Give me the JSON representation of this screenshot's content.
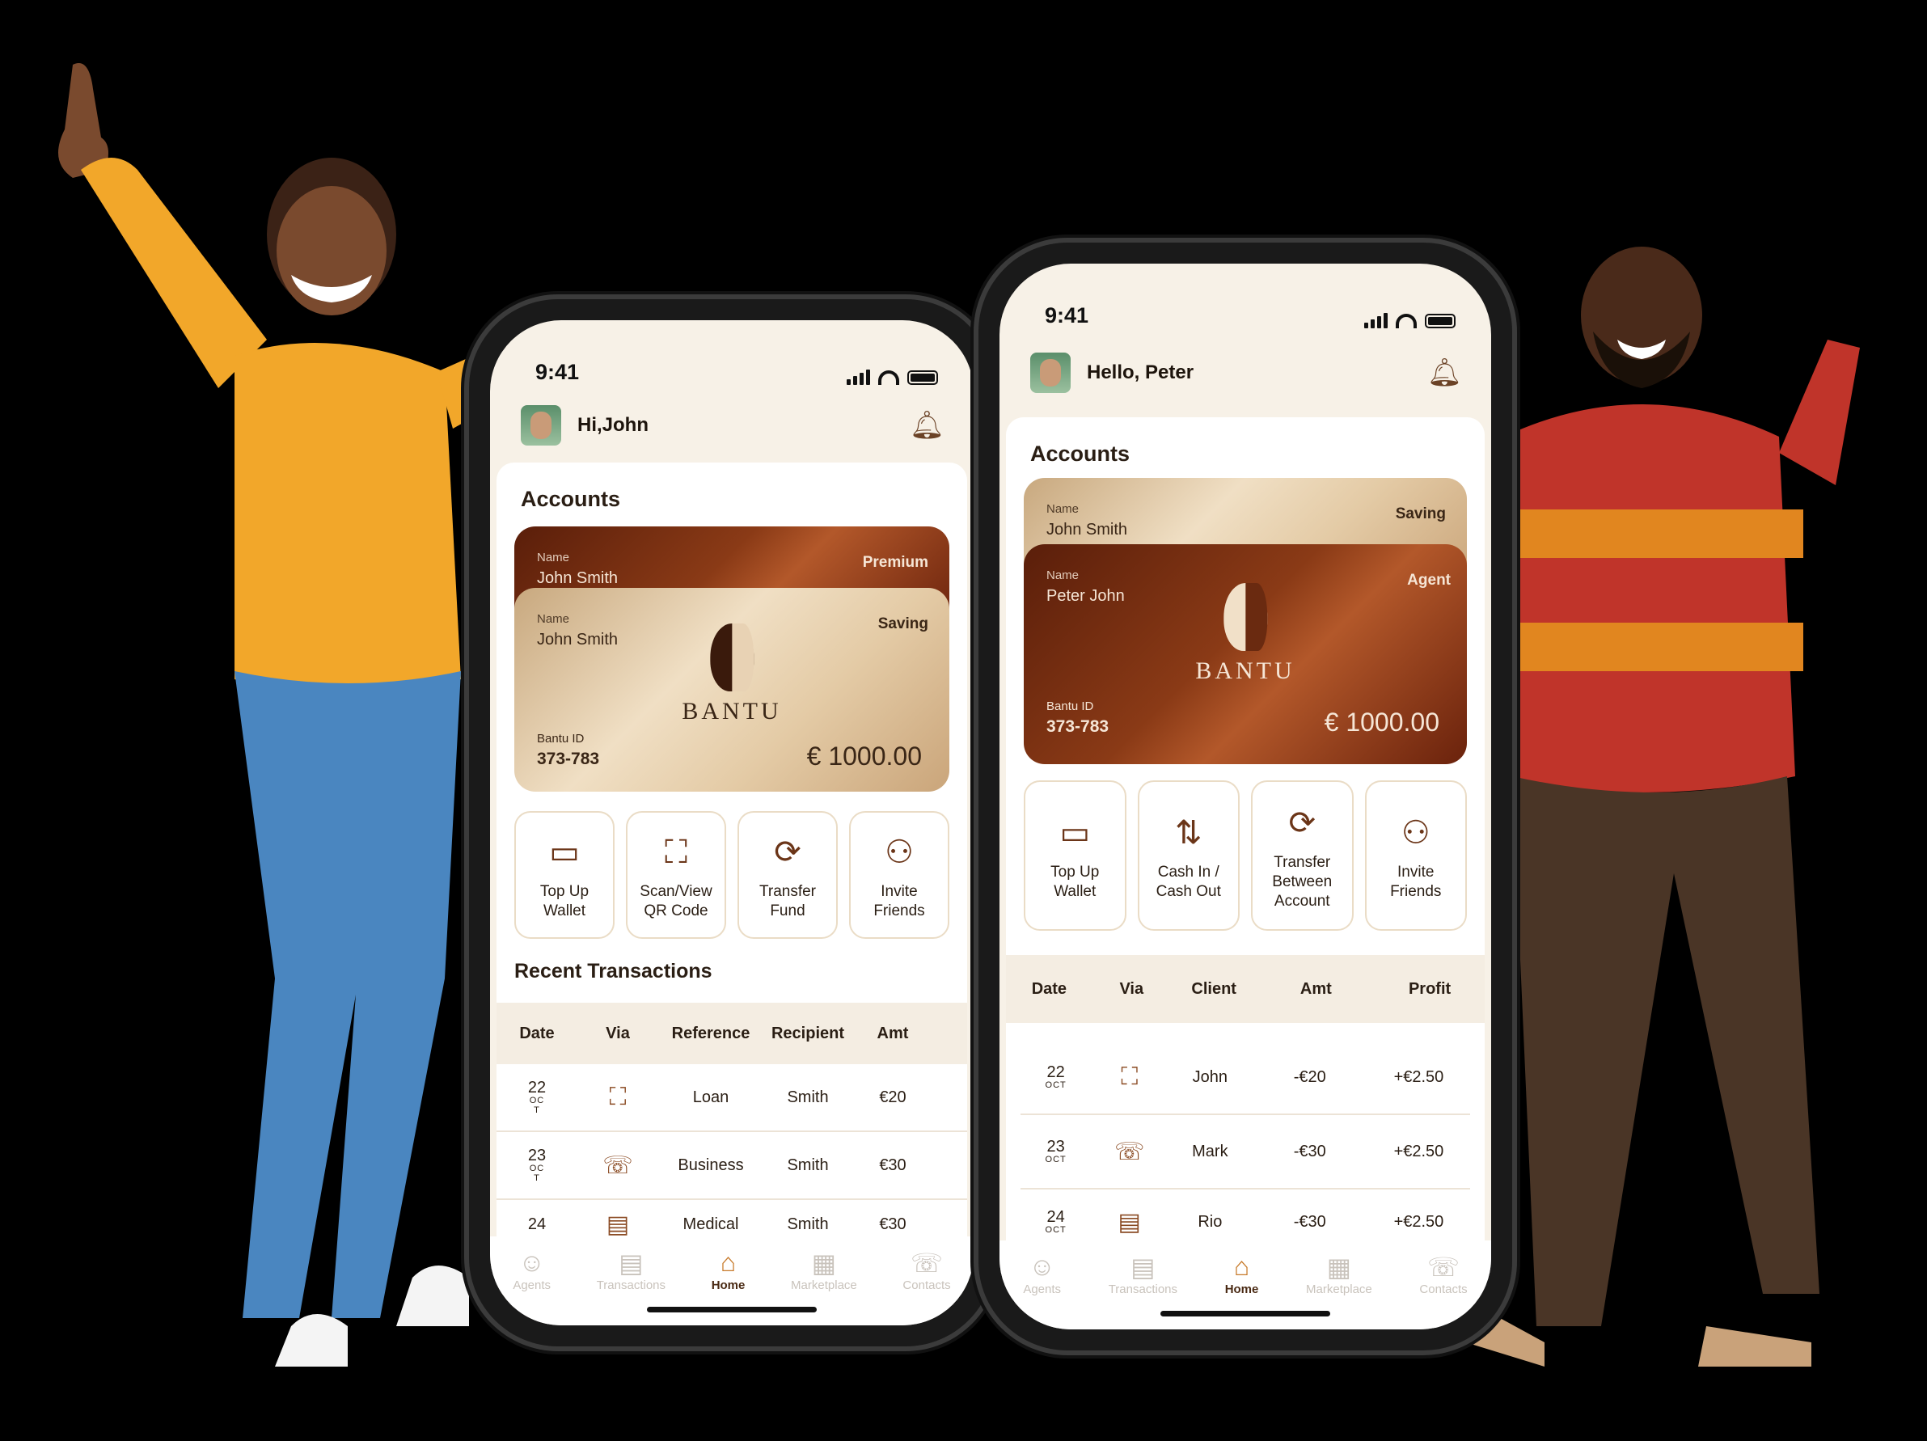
{
  "phone_left": {
    "time": "9:41",
    "greeting": "Hi,John",
    "accounts_title": "Accounts",
    "card_back": {
      "name_label": "Name",
      "name": "John Smith",
      "type": "Premium"
    },
    "card_front": {
      "name_label": "Name",
      "name": "John Smith",
      "type": "Saving",
      "id_label": "Bantu ID",
      "id": "373-783",
      "amount": "€ 1000.00",
      "brand": "BANTU"
    },
    "actions": [
      {
        "label": "Top Up\nWallet",
        "icon": "wallet-icon"
      },
      {
        "label": "Scan/View\nQR Code",
        "icon": "qr-icon"
      },
      {
        "label": "Transfer\nFund",
        "icon": "transfer-icon"
      },
      {
        "label": "Invite\nFriends",
        "icon": "invite-icon"
      }
    ],
    "recent_title": "Recent Transactions",
    "table_headers": [
      "Date",
      "Via",
      "Reference",
      "Recipient",
      "Amt"
    ],
    "rows": [
      {
        "day": "22",
        "month": "OC\nT",
        "via": "qr-icon",
        "reference": "Loan",
        "recipient": "Smith",
        "amt": "€20"
      },
      {
        "day": "23",
        "month": "OC\nT",
        "via": "phone-icon",
        "reference": "Business",
        "recipient": "Smith",
        "amt": "€30"
      },
      {
        "day": "24",
        "month": "",
        "via": "id-card-icon",
        "reference": "Medical",
        "recipient": "Smith",
        "amt": "€30"
      }
    ],
    "tabs": [
      "Agents",
      "Transactions",
      "Home",
      "Marketplace",
      "Contacts"
    ]
  },
  "phone_right": {
    "time": "9:41",
    "greeting": "Hello, Peter",
    "accounts_title": "Accounts",
    "card_back": {
      "name_label": "Name",
      "name": "John Smith",
      "type": "Saving"
    },
    "card_front": {
      "name_label": "Name",
      "name": "Peter John",
      "type": "Agent",
      "id_label": "Bantu ID",
      "id": "373-783",
      "amount": "€ 1000.00",
      "brand": "BANTU"
    },
    "actions": [
      {
        "label": "Top Up\nWallet",
        "icon": "wallet-icon"
      },
      {
        "label": "Cash In /\nCash Out",
        "icon": "cash-icon"
      },
      {
        "label": "Transfer\nBetween\nAccount",
        "icon": "transfer-icon"
      },
      {
        "label": "Invite\nFriends",
        "icon": "invite-icon"
      }
    ],
    "table_headers": [
      "Date",
      "Via",
      "Client",
      "Amt",
      "Profit"
    ],
    "rows": [
      {
        "day": "22",
        "month": "OCT",
        "via": "qr-icon",
        "client": "John",
        "amt": "-€20",
        "profit": "+€2.50"
      },
      {
        "day": "23",
        "month": "OCT",
        "via": "phone-icon",
        "client": "Mark",
        "amt": "-€30",
        "profit": "+€2.50"
      },
      {
        "day": "24",
        "month": "OCT",
        "via": "id-card-icon",
        "client": "Rio",
        "amt": "-€30",
        "profit": "+€2.50"
      }
    ],
    "tabs": [
      "Agents",
      "Transactions",
      "Home",
      "Marketplace",
      "Contacts"
    ]
  },
  "colors": {
    "accent": "#c77a2a",
    "brown": "#6b3518",
    "cream": "#f7f1e7"
  }
}
